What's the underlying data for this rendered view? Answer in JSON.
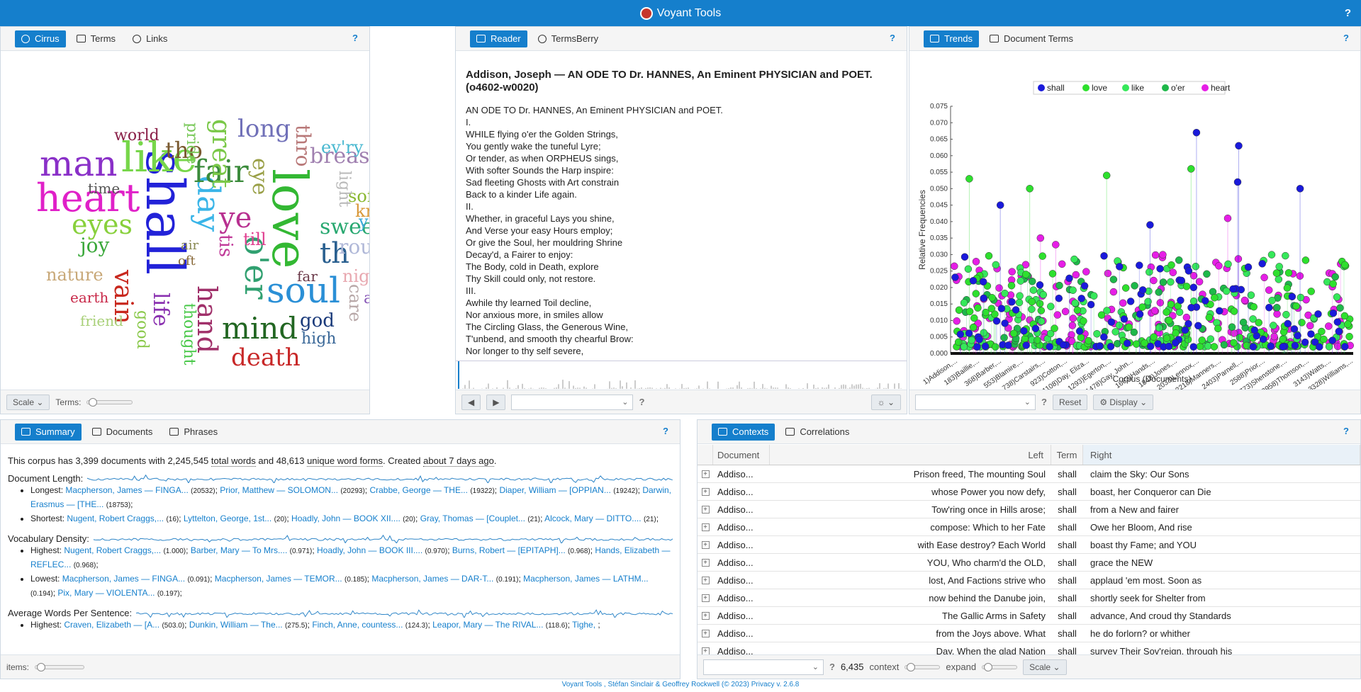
{
  "app": {
    "title": "Voyant Tools",
    "help": "?"
  },
  "cirrus_panel": {
    "tabs": [
      "Cirrus",
      "Terms",
      "Links"
    ],
    "scale_label": "Scale",
    "terms_label": "Terms:",
    "words": [
      "shall",
      "love",
      "heart",
      "like",
      "man",
      "soul",
      "day",
      "fair",
      "mind",
      "o'er",
      "eyes",
      "hand",
      "death",
      "great",
      "long",
      "ye",
      "sweet",
      "vain",
      "th",
      "breast",
      "tho",
      "life",
      "eye",
      "joy",
      "round",
      "nature",
      "world",
      "night",
      "youth",
      "god",
      "thro",
      "tis",
      "soft",
      "know",
      "ev'ry",
      "thought",
      "pride",
      "friend",
      "earth",
      "good",
      "till",
      "care",
      "light",
      "art",
      "far",
      "high",
      "time",
      "air",
      "oft"
    ]
  },
  "reader_panel": {
    "tabs": [
      "Reader",
      "TermsBerry"
    ],
    "title": "Addison, Joseph — AN ODE TO Dr. HANNES, An Eminent PHYSICIAN and POET. (o4602-w0020)",
    "lines": [
      "AN ODE TO Dr. HANNES, An Eminent PHYSICIAN and POET.",
      "I.",
      "WHILE flying o'er the Golden Strings,",
      "You gently wake the tuneful Lyre;",
      "Or tender, as when ORPHEUS sings,",
      "With softer Sounds the Harp inspire:",
      "Sad fleeting Ghosts with Art constrain",
      "Back to a kinder Life again.",
      "II.",
      "Whether, in graceful Lays you shine,",
      "And Verse your easy Hours employ;",
      "Or give the Soul, her mouldring Shrine",
      "Decay'd, a Fairer to enjoy:",
      "The Body, cold in Death, explore",
      "Thy Skill could only, not restore.",
      "III.",
      "Awhile thy learned Toil decline,",
      "Nor anxious more, in smiles allow",
      "The Circling Glass, the Generous Wine,",
      "T'unbend, and smooth thy chearful Brow:",
      "Nor longer to thy self severe,"
    ]
  },
  "trends_panel": {
    "tabs": [
      "Trends",
      "Document Terms"
    ],
    "reset_label": "Reset",
    "display_label": "Display",
    "chart_data": {
      "type": "scatter",
      "xlabel": "Corpus (Documents)",
      "ylabel": "Relative Frequencies",
      "ylim": [
        0,
        0.075
      ],
      "yticks": [
        "0.075",
        "0.070",
        "0.065",
        "0.060",
        "0.055",
        "0.050",
        "0.045",
        "0.040",
        "0.035",
        "0.030",
        "0.025",
        "0.020",
        "0.015",
        "0.010",
        "0.005",
        "0.000"
      ],
      "xticks": [
        "1)Addison,...",
        "183)Baillie,...",
        "368)Barber,...",
        "553)Blamire,...",
        "738)Carstairs,...",
        "923)Cotton,...",
        "1108)Day, Eliza...",
        "1293)Egerton,...",
        "1478)Gay, John...",
        "1663)Hands,...",
        "1848)Jones,...",
        "2033)Lennox,...",
        "2218)Manners,...",
        "2403)Parnell,...",
        "2588)Prior,...",
        "2773)Shenstone,...",
        "2958)Thomson,...",
        "3143)Watts,...",
        "3328)Williams,..."
      ],
      "series": [
        {
          "name": "shall",
          "color": "#1a1adb"
        },
        {
          "name": "love",
          "color": "#2ee02e"
        },
        {
          "name": "like",
          "color": "#36e85a"
        },
        {
          "name": "o'er",
          "color": "#1eb84a"
        },
        {
          "name": "heart",
          "color": "#e61ee6"
        }
      ]
    }
  },
  "summary_panel": {
    "tabs": [
      "Summary",
      "Documents",
      "Phrases"
    ],
    "intro": {
      "a": "This corpus has 3,399 documents with 2,245,545 ",
      "b": "total words",
      "c": " and 48,613 ",
      "d": "unique word forms",
      "e": ". Created ",
      "f": "about 7 days ago",
      "g": "."
    },
    "doc_length_label": "Document Length:",
    "longest_label": "Longest:",
    "longest": [
      [
        "Macpherson, James — FINGA...",
        "(20532)"
      ],
      [
        "Prior, Matthew — SOLOMON...",
        "(20293)"
      ],
      [
        "Crabbe, George — THE...",
        "(19322)"
      ],
      [
        "Diaper, William — [OPPIAN...",
        "(19242)"
      ],
      [
        "Darwin, Erasmus — [THE...",
        "(18753)"
      ]
    ],
    "shortest_label": "Shortest:",
    "shortest": [
      [
        "Nugent, Robert Craggs,...",
        "(16)"
      ],
      [
        "Lyttelton, George, 1st...",
        "(20)"
      ],
      [
        "Hoadly, John — BOOK XII....",
        "(20)"
      ],
      [
        "Gray, Thomas — [Couplet...",
        "(21)"
      ],
      [
        "Alcock, Mary — DITTO....",
        "(21)"
      ]
    ],
    "vocab_label": "Vocabulary Density:",
    "highest_label": "Highest:",
    "vocab_highest": [
      [
        "Nugent, Robert Craggs,...",
        "(1.000)"
      ],
      [
        "Barber, Mary — To Mrs....",
        "(0.971)"
      ],
      [
        "Hoadly, John — BOOK III....",
        "(0.970)"
      ],
      [
        "Burns, Robert — [EPITAPH]...",
        "(0.968)"
      ],
      [
        "Hands, Elizabeth — REFLEC...",
        "(0.968)"
      ]
    ],
    "lowest_label": "Lowest:",
    "vocab_lowest": [
      [
        "Macpherson, James — FINGA...",
        "(0.091)"
      ],
      [
        "Macpherson, James — TEMOR...",
        "(0.185)"
      ],
      [
        "Macpherson, James — DAR-T...",
        "(0.191)"
      ],
      [
        "Macpherson, James — LATHM...",
        "(0.194)"
      ],
      [
        "Pix, Mary — VIOLENTA...",
        "(0.197)"
      ]
    ],
    "avg_label": "Average Words Per Sentence:",
    "avg_highest": [
      [
        "Craven, Elizabeth — [A...",
        "(503.0)"
      ],
      [
        "Dunkin, William — The...",
        "(275.5)"
      ],
      [
        "Finch, Anne, countess...",
        "(124.3)"
      ],
      [
        "Leapor, Mary — The RIVAL...",
        "(118.6)"
      ],
      [
        "Tighe,",
        ""
      ]
    ],
    "items_label": "items:"
  },
  "contexts_panel": {
    "tabs": [
      "Contexts",
      "Correlations"
    ],
    "columns": {
      "doc": "Document",
      "left": "Left",
      "term": "Term",
      "right": "Right"
    },
    "rows": [
      [
        "Addiso...",
        "Prison freed, The mounting Soul",
        "shall",
        "claim the Sky: Our Sons"
      ],
      [
        "Addiso...",
        "whose Power you now defy,",
        "shall",
        "boast, her Conqueror can Die"
      ],
      [
        "Addiso...",
        "Tow'ring once in Hills arose;",
        "shall",
        "from a New and fairer"
      ],
      [
        "Addiso...",
        "compose: Which to her Fate",
        "shall",
        "Owe her Bloom, And rise"
      ],
      [
        "Addiso...",
        "with Ease destroy? Each World",
        "shall",
        "boast thy Fame; and YOU"
      ],
      [
        "Addiso...",
        "YOU, Who charm'd the OLD,",
        "shall",
        "grace the NEW"
      ],
      [
        "Addiso...",
        "lost, And Factions strive who",
        "shall",
        "applaud 'em most. Soon as"
      ],
      [
        "Addiso...",
        "now behind the Danube join,",
        "shall",
        "shortly seek for Shelter from"
      ],
      [
        "Addiso...",
        "The Gallic Arms in Safety",
        "shall",
        "advance, And croud thy Standards"
      ],
      [
        "Addiso...",
        "from the Joys above. What",
        "shall",
        "he do forlorn? or whither"
      ],
      [
        "Addiso...",
        "Day. When the glad Nation",
        "shall",
        "survey Their Sov'reign, through his"
      ]
    ],
    "count": "6,435",
    "context_label": "context",
    "expand_label": "expand",
    "scale_label": "Scale"
  },
  "footer": {
    "credits": "Voyant Tools , Stéfan Sinclair & Geoffrey Rockwell (© 2023) Privacy v. 2.6.8"
  }
}
